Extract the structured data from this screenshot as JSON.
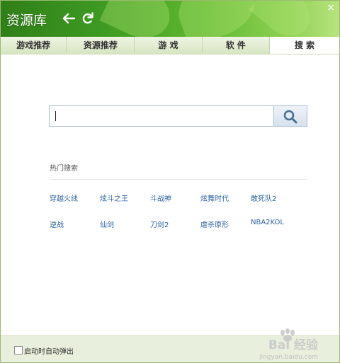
{
  "app": {
    "title": "资源库",
    "close_glyph": "×",
    "icons": [
      "back-arrow-icon",
      "refresh-icon",
      "close-icon",
      "search-icon",
      "checkbox-icon"
    ]
  },
  "tabs": [
    {
      "label": "游戏推荐",
      "active": false
    },
    {
      "label": "资源推荐",
      "active": false
    },
    {
      "label": "游 戏",
      "active": false
    },
    {
      "label": "软 件",
      "active": false
    },
    {
      "label": "搜 索",
      "active": true
    }
  ],
  "search": {
    "value": "",
    "placeholder": ""
  },
  "hot": {
    "label": "热门搜索",
    "items": [
      "穿越火线",
      "炫斗之王",
      "斗战神",
      "炫舞时代",
      "敢死队2",
      "逆战",
      "仙剑",
      "刀剑2",
      "虐杀原形",
      "NBA2KOL"
    ]
  },
  "footer": {
    "checkbox_checked": false,
    "checkbox_label": "启动时自动弹出"
  },
  "watermark": {
    "text": "Bai 经验",
    "sub": "jingyan.baidu.com"
  },
  "colors": {
    "header_dark": "#2f7f18",
    "header_light": "#b8e37e",
    "link": "#2c62a3",
    "footer_bg": "#e8efdc"
  }
}
